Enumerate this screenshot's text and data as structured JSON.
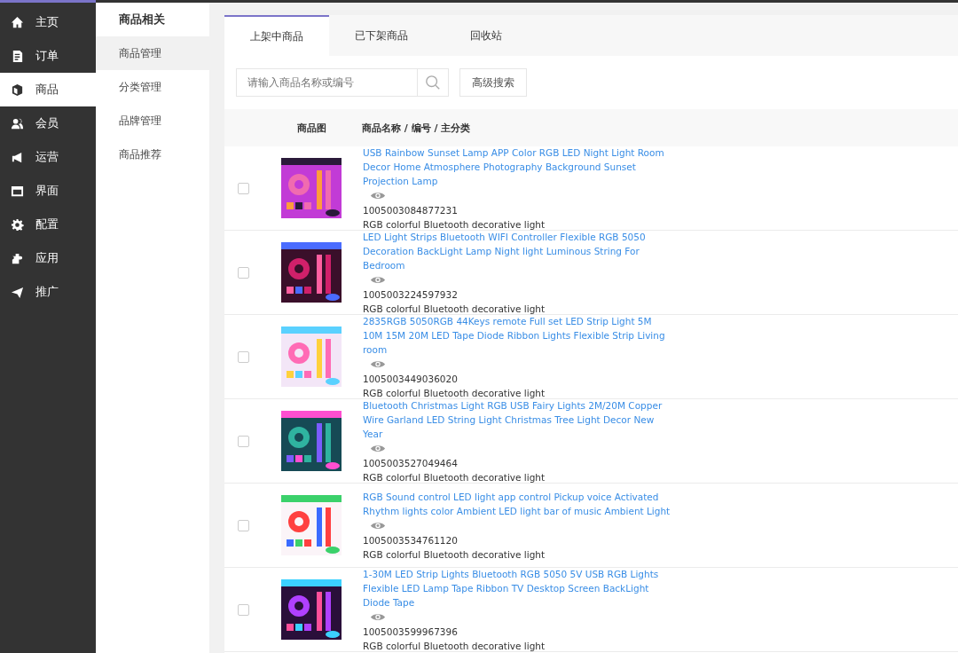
{
  "sidebar": {
    "items": [
      {
        "label": "主页",
        "selected": false
      },
      {
        "label": "订单",
        "selected": false
      },
      {
        "label": "商品",
        "selected": true
      },
      {
        "label": "会员",
        "selected": false
      },
      {
        "label": "运营",
        "selected": false
      },
      {
        "label": "界面",
        "selected": false
      },
      {
        "label": "配置",
        "selected": false
      },
      {
        "label": "应用",
        "selected": false
      },
      {
        "label": "推广",
        "selected": false
      }
    ]
  },
  "submenu": {
    "title": "商品相关",
    "items": [
      {
        "label": "商品管理",
        "selected": true
      },
      {
        "label": "分类管理",
        "selected": false
      },
      {
        "label": "品牌管理",
        "selected": false
      },
      {
        "label": "商品推荐",
        "selected": false
      }
    ]
  },
  "tabs": [
    {
      "label": "上架中商品",
      "selected": true
    },
    {
      "label": "已下架商品",
      "selected": false
    },
    {
      "label": "回收站",
      "selected": false
    }
  ],
  "search": {
    "placeholder": "请输入商品名称或编号",
    "advanced_button": "高级搜索"
  },
  "table": {
    "columns": [
      "商品图",
      "商品名称 / 编号 / 主分类"
    ],
    "rows": [
      {
        "checked": false,
        "title": "USB Rainbow Sunset Lamp APP Color RGB LED Night Light Room Decor Home Atmosphere Photography Background Sunset Projection Lamp",
        "id": "1005003084877231",
        "category": "RGB colorful Bluetooth decorative light"
      },
      {
        "checked": false,
        "title": "LED Light Strips Bluetooth WIFI Controller Flexible RGB 5050 Decoration BackLight Lamp Night light Luminous String For Bedroom",
        "id": "1005003224597932",
        "category": "RGB colorful Bluetooth decorative light"
      },
      {
        "checked": false,
        "title": "2835RGB 5050RGB 44Keys remote Full set LED Strip Light 5M 10M 15M 20M LED Tape Diode Ribbon Lights Flexible Strip Living room",
        "id": "1005003449036020",
        "category": "RGB colorful Bluetooth decorative light"
      },
      {
        "checked": false,
        "title": "Bluetooth Christmas Light RGB USB Fairy Lights 2M/20M Copper Wire Garland LED String Light Christmas Tree Light Decor New Year",
        "id": "1005003527049464",
        "category": "RGB colorful Bluetooth decorative light"
      },
      {
        "checked": false,
        "title": "RGB Sound control LED light app control Pickup voice Activated Rhythm lights color Ambient LED light bar of music Ambient Light",
        "id": "1005003534761120",
        "category": "RGB colorful Bluetooth decorative light"
      },
      {
        "checked": false,
        "title": "1-30M LED Strip Lights Bluetooth RGB 5050 5V USB RGB Lights Flexible LED Lamp Tape Ribbon TV Desktop Screen BackLight Diode Tape",
        "id": "1005003599967396",
        "category": "RGB colorful Bluetooth decorative light"
      }
    ]
  }
}
